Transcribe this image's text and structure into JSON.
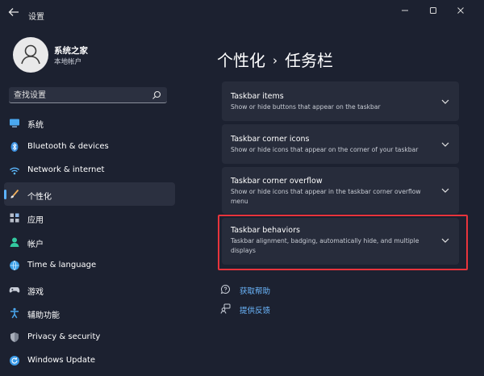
{
  "window": {
    "back_icon": "back-arrow-icon",
    "title": "设置",
    "controls": {
      "minimize": "—",
      "maximize": "☐",
      "close": "✕"
    }
  },
  "user": {
    "name": "系统之家",
    "account": "本地帐户"
  },
  "search": {
    "placeholder": "查找设置",
    "icon": "search-icon"
  },
  "sidebar": {
    "items": [
      {
        "label": "系统",
        "icon": "system-display-icon",
        "active": false
      },
      {
        "label": "Bluetooth & devices",
        "icon": "bluetooth-icon",
        "active": false
      },
      {
        "label": "Network & internet",
        "icon": "wifi-icon",
        "active": false
      },
      {
        "label": "个性化",
        "icon": "brush-icon",
        "active": true
      },
      {
        "label": "应用",
        "icon": "apps-icon",
        "active": false
      },
      {
        "label": "帐户",
        "icon": "account-icon",
        "active": false
      },
      {
        "label": "Time & language",
        "icon": "globe-clock-icon",
        "active": false
      },
      {
        "label": "游戏",
        "icon": "gamepad-icon",
        "active": false
      },
      {
        "label": "辅助功能",
        "icon": "accessibility-icon",
        "active": false
      },
      {
        "label": "Privacy & security",
        "icon": "shield-icon",
        "active": false
      },
      {
        "label": "Windows Update",
        "icon": "update-icon",
        "active": false
      }
    ]
  },
  "main": {
    "breadcrumb": {
      "parent": "个性化",
      "separator": "›",
      "current": "任务栏"
    },
    "cards": [
      {
        "title": "Taskbar items",
        "description": "Show or hide buttons that appear on the taskbar"
      },
      {
        "title": "Taskbar corner icons",
        "description": "Show or hide icons that appear on the corner of your taskbar"
      },
      {
        "title": "Taskbar corner overflow",
        "description": "Show or hide icons that appear in the taskbar corner overflow menu"
      },
      {
        "title": "Taskbar behaviors",
        "description": "Taskbar alignment, badging, automatically hide, and multiple displays"
      }
    ],
    "links": [
      {
        "label": "获取帮助",
        "icon": "help-icon"
      },
      {
        "label": "提供反馈",
        "icon": "feedback-icon"
      }
    ]
  },
  "colors": {
    "background": "#1c2130",
    "card": "#272c3b",
    "accent": "#5cb2ff",
    "highlight_border": "#e8343c"
  }
}
